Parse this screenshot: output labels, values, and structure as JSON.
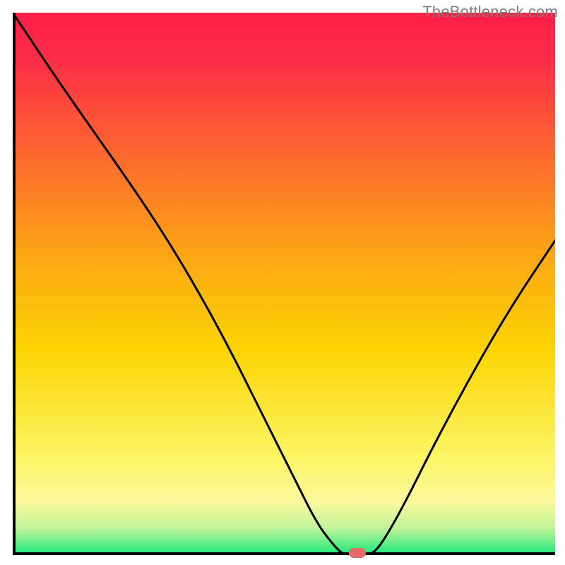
{
  "watermark": "TheBottleneck.com",
  "colors": {
    "gradient_top": "#fd1f48",
    "gradient_mid": "#fcd402",
    "gradient_low": "#fdf99c",
    "gradient_bottom": "#18e87c",
    "axis": "#000000",
    "curve": "#000000",
    "minpoint": "#e46a6a"
  },
  "chart_data": {
    "type": "line",
    "title": "",
    "xlabel": "",
    "ylabel": "",
    "xlim": [
      0,
      100
    ],
    "ylim": [
      0,
      100
    ],
    "x": [
      0,
      2,
      8,
      15,
      22,
      28,
      34,
      40,
      46,
      52,
      56,
      59,
      61,
      63,
      66,
      68,
      72,
      78,
      85,
      92,
      100
    ],
    "values": [
      100,
      97,
      88,
      78,
      68,
      59,
      49,
      38,
      26,
      14,
      6,
      2,
      0,
      0,
      0,
      2,
      9,
      21,
      34,
      46,
      58
    ],
    "min_region_x": [
      61,
      66
    ],
    "annotations": []
  }
}
